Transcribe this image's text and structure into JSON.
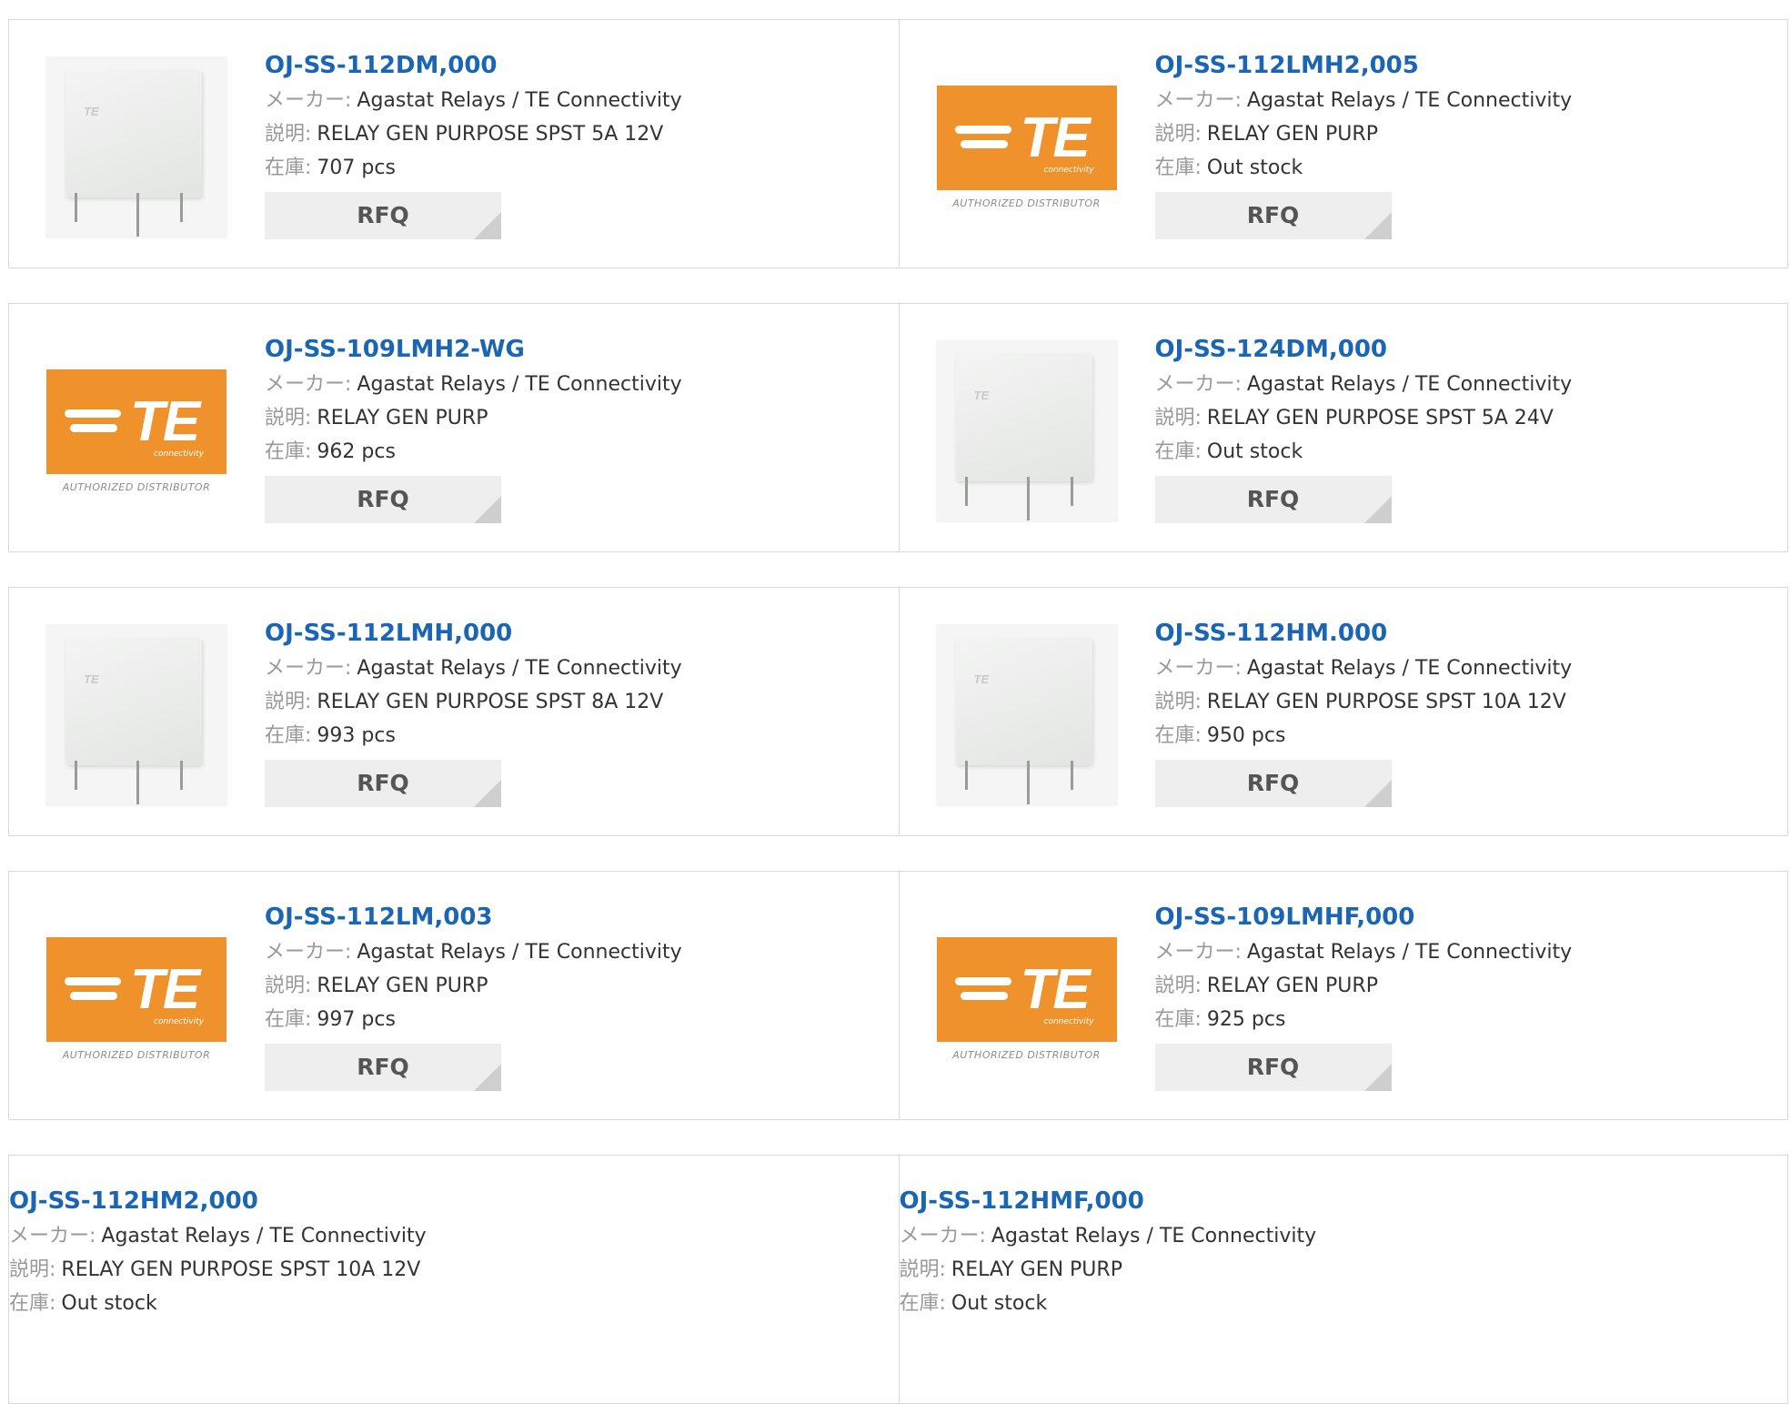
{
  "labels": {
    "maker": "メーカー:",
    "desc": "説明:",
    "stock": "在庫:",
    "rfq": "RFQ"
  },
  "logo": {
    "brand_text": "TE",
    "brand_sub": "connectivity",
    "authorized": "AUTHORIZED DISTRIBUTOR",
    "brand_color": "#f0922b"
  },
  "colors": {
    "title_link": "#1a66b5",
    "label": "#999999",
    "rfq_bg": "#eeeeee"
  },
  "products": [
    {
      "title": "OJ-SS-112DM,000",
      "maker": "Agastat Relays / TE Connectivity",
      "desc": "RELAY GEN PURPOSE SPST 5A 12V",
      "stock": "707 pcs",
      "image": "relay-photo"
    },
    {
      "title": "OJ-SS-112LMH2,005",
      "maker": "Agastat Relays / TE Connectivity",
      "desc": "RELAY GEN PURP",
      "stock": "Out stock",
      "image": "te-logo"
    },
    {
      "title": "OJ-SS-109LMH2-WG",
      "maker": "Agastat Relays / TE Connectivity",
      "desc": "RELAY GEN PURP",
      "stock": "962 pcs",
      "image": "te-logo"
    },
    {
      "title": "OJ-SS-124DM,000",
      "maker": "Agastat Relays / TE Connectivity",
      "desc": "RELAY GEN PURPOSE SPST 5A 24V",
      "stock": "Out stock",
      "image": "relay-photo"
    },
    {
      "title": "OJ-SS-112LMH,000",
      "maker": "Agastat Relays / TE Connectivity",
      "desc": "RELAY GEN PURPOSE SPST 8A 12V",
      "stock": "993 pcs",
      "image": "relay-photo"
    },
    {
      "title": "OJ-SS-112HM.000",
      "maker": "Agastat Relays / TE Connectivity",
      "desc": "RELAY GEN PURPOSE SPST 10A 12V",
      "stock": "950 pcs",
      "image": "relay-photo"
    },
    {
      "title": "OJ-SS-112LM,003",
      "maker": "Agastat Relays / TE Connectivity",
      "desc": "RELAY GEN PURP",
      "stock": "997 pcs",
      "image": "te-logo"
    },
    {
      "title": "OJ-SS-109LMHF,000",
      "maker": "Agastat Relays / TE Connectivity",
      "desc": "RELAY GEN PURP",
      "stock": "925 pcs",
      "image": "te-logo"
    },
    {
      "title": "OJ-SS-112HM2,000",
      "maker": "Agastat Relays / TE Connectivity",
      "desc": "RELAY GEN PURPOSE SPST 10A 12V",
      "stock": "Out stock",
      "image": ""
    },
    {
      "title": "OJ-SS-112HMF,000",
      "maker": "Agastat Relays / TE Connectivity",
      "desc": "RELAY GEN PURP",
      "stock": "Out stock",
      "image": ""
    }
  ]
}
